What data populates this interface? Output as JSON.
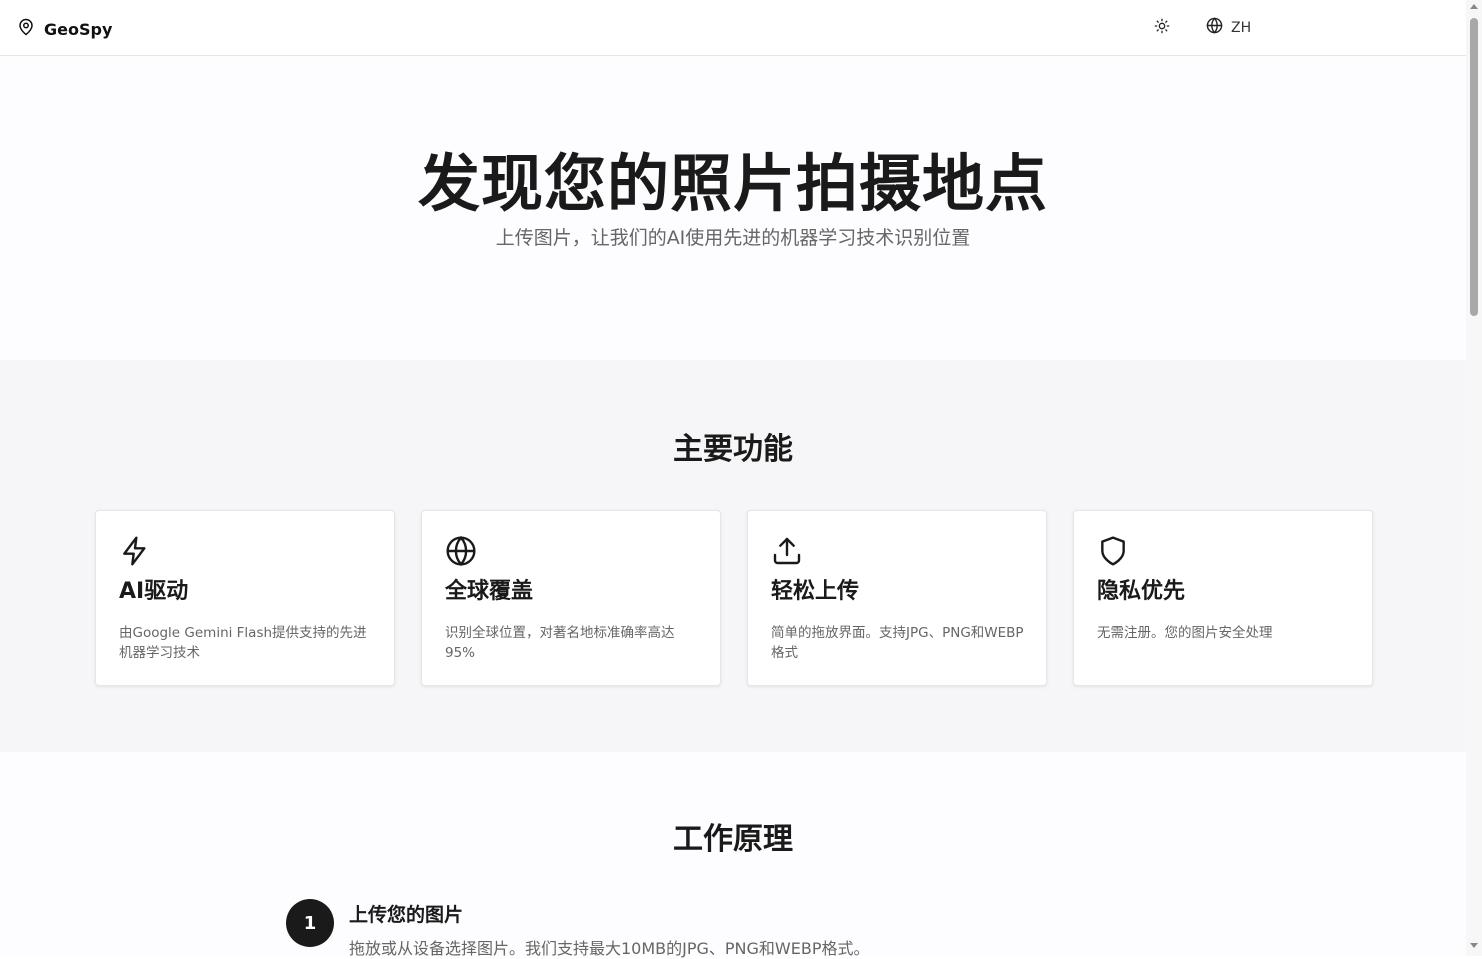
{
  "header": {
    "brand_icon": "map-pin-icon",
    "brand_name": "GeoSpy",
    "theme_icon": "sun-icon",
    "lang_icon": "globe-icon",
    "lang_label": "ZH"
  },
  "hero": {
    "title": "发现您的照片拍摄地点",
    "subtitle": "上传图片，让我们的AI使用先进的机器学习技术识别位置"
  },
  "features": {
    "title": "主要功能",
    "cards": [
      {
        "icon": "lightning-icon",
        "title": "AI驱动",
        "desc": "由Google Gemini Flash提供支持的先进机器学习技术"
      },
      {
        "icon": "globe-icon",
        "title": "全球覆盖",
        "desc": "识别全球位置，对著名地标准确率高达95%"
      },
      {
        "icon": "upload-icon",
        "title": "轻松上传",
        "desc": "简单的拖放界面。支持JPG、PNG和WEBP格式"
      },
      {
        "icon": "shield-icon",
        "title": "隐私优先",
        "desc": "无需注册。您的图片安全处理"
      }
    ]
  },
  "how": {
    "title": "工作原理",
    "steps": [
      {
        "number": "1",
        "title": "上传您的图片",
        "desc": "拖放或从设备选择图片。我们支持最大10MB的JPG、PNG和WEBP格式。"
      }
    ]
  },
  "colors": {
    "text_primary": "#1a1a1a",
    "text_secondary": "#666666",
    "section_bg": "#f6f5f7",
    "step_badge": "#1a1a1a"
  }
}
